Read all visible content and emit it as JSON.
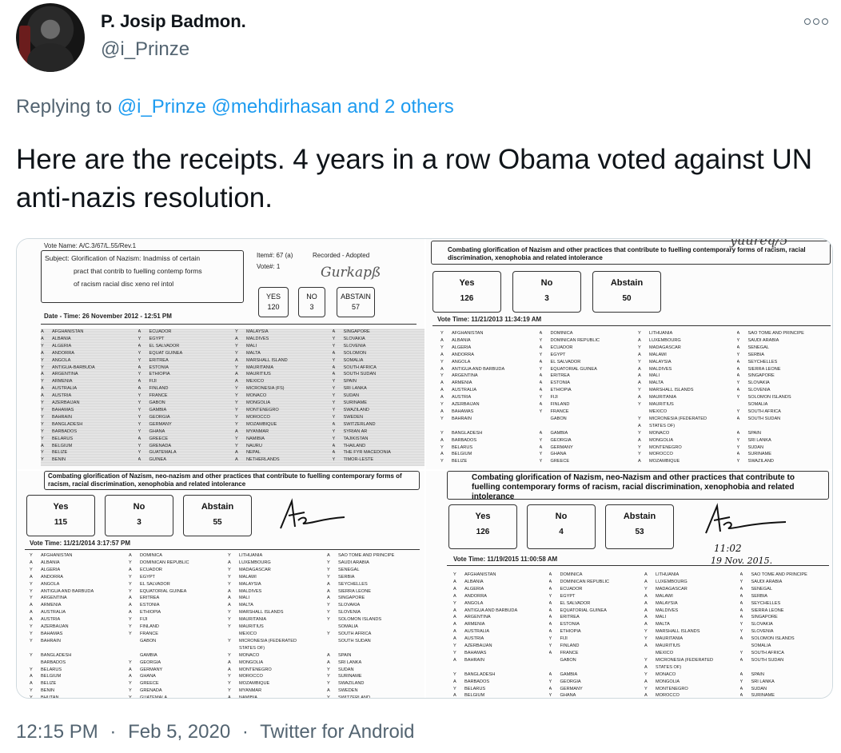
{
  "tweet": {
    "display_name": "P. Josip Badmon.",
    "handle": "@i_Prinze",
    "replying_prefix": "Replying to",
    "replying_to": [
      "@i_Prinze",
      "@mehdirhasan"
    ],
    "replying_others": "and 2 others",
    "text": "Here are the receipts. 4 years in a row Obama voted against UN anti-nazis resolution.",
    "time": "12:15 PM",
    "date": "Feb 5, 2020",
    "client": "Twitter for Android",
    "separator": "·",
    "more_icon": "more-horizontal-icon"
  },
  "docs": {
    "a": {
      "vote_name": "Vote Name: A/C.3/67/L.55/Rev.1",
      "subject_line1": "Subject: Glorification of Nazism: Inadmiss   of certain",
      "subject_line2": "pract that contrib to   fuelling contemp forms",
      "subject_line3": "of racism   racial disc  xeno  rel intol",
      "item": "Item#: 67 (a)",
      "vote_no": "Vote#: 1",
      "recorded": "Recorded - Adopted",
      "handwriting": "Gurkapß",
      "yes_label": "YES",
      "yes_value": "120",
      "no_label": "NO",
      "no_value": "3",
      "abstain_label": "ABSTAIN",
      "abstain_value": "57",
      "datetime": "Date - Time: 26 November 2012 - 12:51 PM",
      "countries": [
        [
          "AFGHANISTAN",
          "ALBANIA",
          "ALGERIA",
          "ANDORRA",
          "ANGOLA",
          "ANTIGUA-BARBUDA",
          "ARGENTINA",
          "ARMENIA",
          "AUSTRALIA",
          "AUSTRIA",
          "AZERBAIJAN",
          "BAHAMAS",
          "BAHRAIN",
          "BANGLADESH",
          "BARBADOS",
          "BELARUS",
          "BELGIUM",
          "BELIZE",
          "BENIN"
        ],
        [
          "ECUADOR",
          "EGYPT",
          "EL SALVADOR",
          "EQUAT GUINEA",
          "ERITREA",
          "ESTONIA",
          "ETHIOPIA",
          "FIJI",
          "FINLAND",
          "FRANCE",
          "GABON",
          "GAMBIA",
          "GEORGIA",
          "GERMANY",
          "GHANA",
          "GREECE",
          "GRENADA",
          "GUATEMALA",
          "GUINEA"
        ],
        [
          "MALAYSIA",
          "MALDIVES",
          "MALI",
          "MALTA",
          "MARSHALL ISLAND",
          "MAURITANIA",
          "MAURITIUS",
          "MEXICO",
          "MICRONESIA (FS)",
          "MONACO",
          "MONGOLIA",
          "MONTENEGRO",
          "MOROCCO",
          "MOZAMBIQUE",
          "MYANMAR",
          "NAMIBIA",
          "NAURU",
          "NEPAL",
          "NETHERLANDS"
        ],
        [
          "SINGAPORE",
          "SLOVAKIA",
          "SLOVENIA",
          "SOLOMON",
          "SOMALIA",
          "SOUTH AFRICA",
          "SOUTH SUDAN",
          "SPAIN",
          "SRI LANKA",
          "SUDAN",
          "SURINAME",
          "SWAZILAND",
          "SWEDEN",
          "SWITZERLAND",
          "SYRIAN AR",
          "TAJIKISTAN",
          "THAILAND",
          "THE FYR MACEDONIA",
          "TIMOR-LESTE"
        ]
      ],
      "marks": [
        "A",
        "A",
        "Y",
        "A",
        "Y",
        "Y",
        "A",
        "Y",
        "A",
        "A",
        "Y",
        "Y",
        "Y",
        "Y",
        "Y",
        "Y",
        "A",
        "Y",
        "Y"
      ]
    },
    "b": {
      "handwriting": "yuureq/5",
      "title": "Combating glorification of Nazism and other practices that contribute to fuelling contemporary forms of racism, racial discrimination, xenophobia and related intolerance",
      "yes_label": "Yes",
      "yes_value": "126",
      "no_label": "No",
      "no_value": "3",
      "abstain_label": "Abstain",
      "abstain_value": "50",
      "vote_time": "Vote Time:  11/21/2013 11:34:19 AM",
      "countries": [
        [
          "AFGHANISTAN",
          "ALBANIA",
          "ALGERIA",
          "ANDORRA",
          "ANGOLA",
          "ANTIGUA AND BARBUDA",
          "ARGENTINA",
          "ARMENIA",
          "AUSTRALIA",
          "AUSTRIA",
          "AZERBAIJAN",
          "BAHAMAS",
          "BAHRAIN",
          "",
          "BANGLADESH",
          "BARBADOS",
          "BELARUS",
          "BELGIUM",
          "BELIZE"
        ],
        [
          "DOMINICA",
          "DOMINICAN REPUBLIC",
          "ECUADOR",
          "EGYPT",
          "EL SALVADOR",
          "EQUATORIAL GUINEA",
          "ERITREA",
          "ESTONIA",
          "ETHIOPIA",
          "FIJI",
          "FINLAND",
          "FRANCE",
          "GABON",
          "",
          "GAMBIA",
          "GEORGIA",
          "GERMANY",
          "GHANA",
          "GREECE"
        ],
        [
          "LITHUANIA",
          "LUXEMBOURG",
          "MADAGASCAR",
          "MALAWI",
          "MALAYSIA",
          "MALDIVES",
          "MALI",
          "MALTA",
          "MARSHALL ISLANDS",
          "MAURITANIA",
          "MAURITIUS",
          "MEXICO",
          "MICRONESIA (FEDERATED",
          "STATES OF)",
          "MONACO",
          "MONGOLIA",
          "MONTENEGRO",
          "MOROCCO",
          "MOZAMBIQUE"
        ],
        [
          "SAO TOME AND PRINCIPE",
          "SAUDI ARABIA",
          "SENEGAL",
          "SERBIA",
          "SEYCHELLES",
          "SIERRA LEONE",
          "SINGAPORE",
          "SLOVAKIA",
          "SLOVENIA",
          "SOLOMON ISLANDS",
          "SOMALIA",
          "SOUTH AFRICA",
          "SOUTH SUDAN",
          "",
          "SPAIN",
          "SRI LANKA",
          "SUDAN",
          "SURINAME",
          "SWAZILAND"
        ]
      ],
      "marks": [
        "Y",
        "A",
        "Y",
        "A",
        "Y",
        "A",
        "Y",
        "A",
        "A",
        "A",
        "Y",
        "A",
        "Y",
        "",
        "Y",
        "A",
        "Y",
        "A",
        "Y"
      ]
    },
    "c": {
      "title": "Combating glorification of Nazism, neo-nazism and other practices that contribute to fuelling contemporary forms of racism, racial discrimination, xenophobia and related intolerance",
      "yes_label": "Yes",
      "yes_value": "115",
      "no_label": "No",
      "no_value": "3",
      "abstain_label": "Abstain",
      "abstain_value": "55",
      "vote_time": "Vote Time:  11/21/2014 3:17:57 PM",
      "countries": [
        [
          "AFGHANISTAN",
          "ALBANIA",
          "ALGERIA",
          "ANDORRA",
          "ANGOLA",
          "ANTIGUA AND BARBUDA",
          "ARGENTINA",
          "ARMENIA",
          "AUSTRALIA",
          "AUSTRIA",
          "AZERBAIJAN",
          "BAHAMAS",
          "BAHRAIN",
          "",
          "BANGLADESH",
          "BARBADOS",
          "BELARUS",
          "BELGIUM",
          "BELIZE",
          "BENIN",
          "BHUTAN"
        ],
        [
          "DOMINICA",
          "DOMINICAN REPUBLIC",
          "ECUADOR",
          "EGYPT",
          "EL SALVADOR",
          "EQUATORIAL GUINEA",
          "ERITREA",
          "ESTONIA",
          "ETHIOPIA",
          "FIJI",
          "FINLAND",
          "FRANCE",
          "GABON",
          "",
          "GAMBIA",
          "GEORGIA",
          "GERMANY",
          "GHANA",
          "GREECE",
          "GRENADA",
          "GUATEMALA"
        ],
        [
          "LITHUANIA",
          "LUXEMBOURG",
          "MADAGASCAR",
          "MALAWI",
          "MALAYSIA",
          "MALDIVES",
          "MALI",
          "MALTA",
          "MARSHALL ISLANDS",
          "MAURITANIA",
          "MAURITIUS",
          "MEXICO",
          "MICRONESIA (FEDERATED",
          "STATES OF)",
          "MONACO",
          "MONGOLIA",
          "MONTENEGRO",
          "MOROCCO",
          "MOZAMBIQUE",
          "MYANMAR",
          "NAMIBIA"
        ],
        [
          "SAO TOME AND PRINCIPE",
          "SAUDI ARABIA",
          "SENEGAL",
          "SERBIA",
          "SEYCHELLES",
          "SIERRA LEONE",
          "SINGAPORE",
          "SLOVAKIA",
          "SLOVENIA",
          "SOLOMON ISLANDS",
          "SOMALIA",
          "SOUTH AFRICA",
          "SOUTH SUDAN",
          "",
          "SPAIN",
          "SRI LANKA",
          "SUDAN",
          "SURINAME",
          "SWAZILAND",
          "SWEDEN",
          "SWITZERLAND"
        ]
      ],
      "marks": [
        "Y",
        "A",
        "Y",
        "A",
        "Y",
        "Y",
        "Y",
        "A",
        "A",
        "A",
        "Y",
        "Y",
        "Y",
        "",
        "Y",
        "",
        "Y",
        "A",
        "A",
        "Y",
        "Y"
      ]
    },
    "d": {
      "title": "Combating glorification of Nazism, neo-Nazism and other practices that contribute to fuelling contemporary forms of racism, racial discrimination, xenophobia and related intolerance",
      "yes_label": "Yes",
      "yes_value": "126",
      "no_label": "No",
      "no_value": "4",
      "abstain_label": "Abstain",
      "abstain_value": "53",
      "handwriting_time": "11:02",
      "handwriting_date": "19 Nov. 2015.",
      "vote_time": "Vote Time:  11/19/2015 11:00:58 AM",
      "countries": [
        [
          "AFGHANISTAN",
          "ALBANIA",
          "ALGERIA",
          "ANDORRA",
          "ANGOLA",
          "ANTIGUA AND BARBUDA",
          "ARGENTINA",
          "ARMENIA",
          "AUSTRALIA",
          "AUSTRIA",
          "AZERBAIJAN",
          "BAHAMAS",
          "BAHRAIN",
          "",
          "BANGLADESH",
          "BARBADOS",
          "BELARUS",
          "BELGIUM"
        ],
        [
          "DOMINICA",
          "DOMINICAN REPUBLIC",
          "ECUADOR",
          "EGYPT",
          "EL SALVADOR",
          "EQUATORIAL GUINEA",
          "ERITREA",
          "ESTONIA",
          "ETHIOPIA",
          "FIJI",
          "FINLAND",
          "FRANCE",
          "GABON",
          "",
          "GAMBIA",
          "GEORGIA",
          "GERMANY",
          "GHANA"
        ],
        [
          "LITHUANIA",
          "LUXEMBOURG",
          "MADAGASCAR",
          "MALAWI",
          "MALAYSIA",
          "MALDIVES",
          "MALI",
          "MALTA",
          "MARSHALL ISLANDS",
          "MAURITANIA",
          "MAURITIUS",
          "MEXICO",
          "MICRONESIA (FEDERATED",
          "STATES OF)",
          "MONACO",
          "MONGOLIA",
          "MONTENEGRO",
          "MOROCCO"
        ],
        [
          "SAO TOME AND PRINCIPE",
          "SAUDI ARABIA",
          "SENEGAL",
          "SERBIA",
          "SEYCHELLES",
          "SIERRA LEONE",
          "SINGAPORE",
          "SLOVAKIA",
          "SLOVENIA",
          "SOLOMON ISLANDS",
          "SOMALIA",
          "SOUTH AFRICA",
          "SOUTH SUDAN",
          "",
          "SPAIN",
          "SRI LANKA",
          "SUDAN",
          "SURINAME"
        ]
      ],
      "marks": [
        "Y",
        "A",
        "A",
        "A",
        "Y",
        "A",
        "A",
        "A",
        "A",
        "A",
        "Y",
        "Y",
        "A",
        "",
        "Y",
        "A",
        "Y",
        "A"
      ]
    }
  }
}
